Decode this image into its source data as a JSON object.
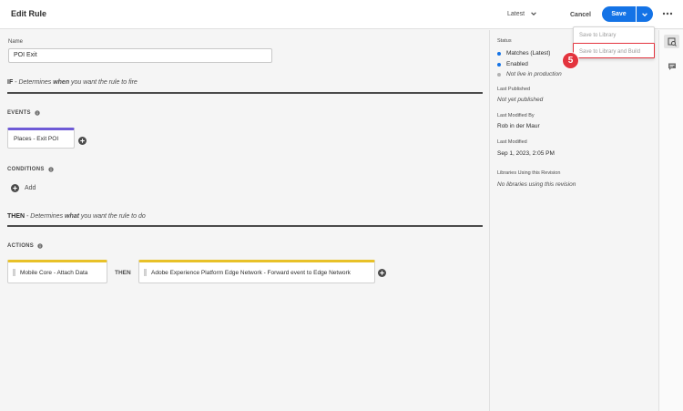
{
  "header": {
    "title": "Edit Rule",
    "revision": "Latest",
    "cancel_label": "Cancel",
    "save_label": "Save"
  },
  "save_menu": {
    "items": [
      "Save to Library",
      "Save to Library and Build"
    ],
    "highlighted_index": 1,
    "step_number": "5"
  },
  "form": {
    "name_label": "Name",
    "name_value": "POI Exit"
  },
  "if_section": {
    "keyword": "IF",
    "pre": " - Determines ",
    "emph": "when",
    "post": " you want the rule to fire"
  },
  "events": {
    "heading": "EVENTS",
    "items": [
      "Places - Exit POI"
    ]
  },
  "conditions": {
    "heading": "CONDITIONS",
    "add_label": "Add"
  },
  "then_section": {
    "keyword": "THEN",
    "pre": " - Determines ",
    "emph": "what",
    "post": " you want the rule to do"
  },
  "actions": {
    "heading": "ACTIONS",
    "items": [
      "Mobile Core - Attach Data",
      "Adobe Experience Platform Edge Network - Forward event to Edge Network"
    ],
    "connector": "THEN"
  },
  "side_panel": {
    "status_label": "Status",
    "status_items": [
      {
        "text": "Matches (Latest)",
        "color": "#1473e6"
      },
      {
        "text": "Enabled",
        "color": "#1473e6"
      },
      {
        "text": "Not live in production",
        "color": "#b3b3b3"
      }
    ],
    "last_published_label": "Last Published",
    "last_published_value": "Not yet published",
    "last_modified_by_label": "Last Modified By",
    "last_modified_by_value": "Rob in der Maur",
    "last_modified_label": "Last Modified",
    "last_modified_value": "Sep 1, 2023, 2:05 PM",
    "libraries_label": "Libraries Using this Revision",
    "libraries_value": "No libraries using this revision"
  },
  "colors": {
    "accent": "#1473e6",
    "event_bar": "#6e5ad6",
    "action_bar": "#e8c128",
    "highlight": "#e3343e"
  }
}
